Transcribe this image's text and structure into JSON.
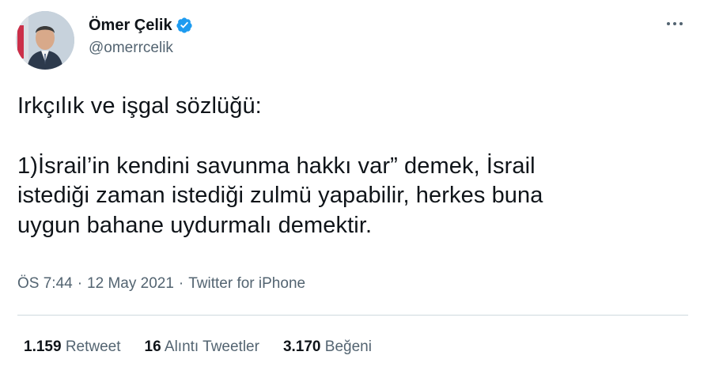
{
  "author": {
    "display_name": "Ömer Çelik",
    "handle": "@omerrcelik",
    "verified": true,
    "verified_color": "#1d9bf0"
  },
  "tweet": {
    "lines": [
      "Irkçılık ve işgal sözlüğü:",
      "",
      "1)İsrail’in kendini savunma hakkı var” demek, İsrail",
      "istediği zaman istediği zulmü yapabilir, herkes buna",
      "uygun bahane uydurmalı demektir."
    ],
    "time": "ÖS 7:44",
    "date": "12 May 2021",
    "source": "Twitter for iPhone"
  },
  "stats": [
    {
      "count": "1.159",
      "label": "Retweet"
    },
    {
      "count": "16",
      "label": "Alıntı Tweetler"
    },
    {
      "count": "3.170",
      "label": "Beğeni"
    }
  ]
}
